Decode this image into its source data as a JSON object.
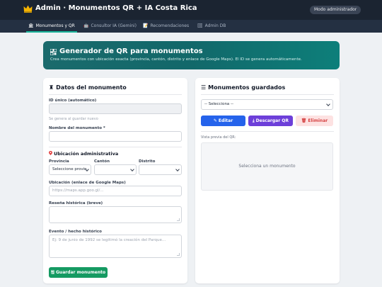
{
  "header": {
    "title": "Admin · Monumentos QR + IA Costa Rica",
    "mode_badge": "Modo administrador",
    "brand_color": "#1b2431",
    "crown_color": "#f5b301"
  },
  "nav": {
    "tabs": [
      {
        "label": "Monumentos y QR",
        "icon": "landmark-icon",
        "active": true
      },
      {
        "label": "Consultor IA (Gemini)",
        "icon": "robot-icon",
        "active": false
      },
      {
        "label": "Recomendaciones",
        "icon": "notepad-icon",
        "active": false
      },
      {
        "label": "Admin DB",
        "icon": "database-icon",
        "active": false
      }
    ],
    "accent": "#19b49a"
  },
  "hero": {
    "title": "Generador de QR para monumentos",
    "subtitle": "Crea monumentos con ubicación exacta (provincia, cantón, distrito y enlace de Google Maps). El ID se genera automáticamente."
  },
  "form": {
    "title": "Datos del monumento",
    "id_label": "ID único (automático)",
    "id_value": "",
    "id_hint": "Se genera al guardar nuevo",
    "name_label": "Nombre del monumento *",
    "name_value": "",
    "admin_section": "Ubicación administrativa",
    "province_label": "Provincia",
    "province_value": "Seleccione provin",
    "canton_label": "Cantón",
    "canton_value": "",
    "district_label": "Distrito",
    "district_value": "",
    "maps_label": "Ubicación (enlace de Google Maps)",
    "maps_placeholder": "https://maps.app.goo.gl/...",
    "history_label": "Reseña histórica (breve)",
    "history_value": "",
    "event_label": "Evento / hecho histórico",
    "event_placeholder": "Ej: 9 de junio de 1992 se legitimó la creación del Parque...",
    "save_label": "Guardar monumento"
  },
  "saved": {
    "title": "Monumentos guardados",
    "select_value": "-- Selecciona --",
    "edit_label": "Editar",
    "qr_label": "Descargar QR",
    "delete_label": "Eliminar",
    "preview_label": "Vista previa del QR:",
    "preview_empty": "Selecciona un monumento"
  }
}
